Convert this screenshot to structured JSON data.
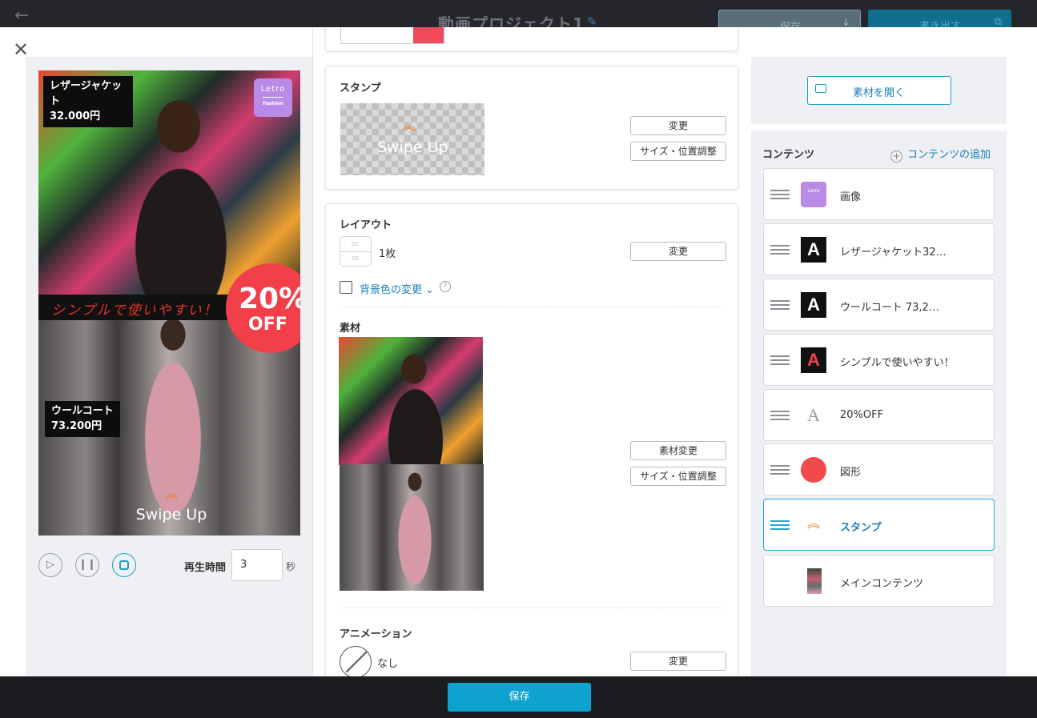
{
  "topbar": {
    "back_icon": "arrow-left-icon",
    "project_title": "動画プロジェクト1",
    "edit_icon": "pencil-icon",
    "save_label": "保存",
    "export_label": "書き出す"
  },
  "modal": {
    "close_icon": "close-icon",
    "preview": {
      "tag_top_line1": "レザージャケット",
      "tag_top_line2": "32.000円",
      "logo_line1": "Letro",
      "logo_line2": "Fashion",
      "catch_text": "シンプルで使いやすい！",
      "badge_percent": "20%",
      "badge_off": "OFF",
      "tag_mid_line1": "ウールコート",
      "tag_mid_line2": "73.200円",
      "stamp_text": "Swipe Up"
    },
    "controls": {
      "duration_label": "再生時間",
      "duration_value": "3",
      "duration_unit": "秒"
    },
    "stamp_section": {
      "title": "スタンプ",
      "stamp_text": "Swipe Up",
      "change_label": "変更",
      "size_label": "サイズ・位置調整"
    },
    "layout_section": {
      "title": "レイアウト",
      "layout_value": "1枚",
      "change_label": "変更",
      "bg_color_label": "背景色の変更 ⌄"
    },
    "material_section": {
      "title": "素材",
      "change_material_label": "素材変更",
      "size_label": "サイズ・位置調整"
    },
    "animation_section": {
      "title": "アニメーション",
      "value": "なし",
      "change_label": "変更"
    },
    "right": {
      "open_material_label": "素材を開く",
      "contents_title": "コンテンツ",
      "add_content_label": "コンテンツの追加",
      "items": [
        {
          "label": "画像",
          "thumb": "image"
        },
        {
          "label": "レザージャケット32…",
          "thumb": "text-A"
        },
        {
          "label": "ウールコート 73,2…",
          "thumb": "text-A"
        },
        {
          "label": "シンプルで使いやすい！",
          "thumb": "text-A-red"
        },
        {
          "label": "20%OFF",
          "thumb": "text-A-outline"
        },
        {
          "label": "図形",
          "thumb": "circle"
        },
        {
          "label": "スタンプ",
          "thumb": "chevron-up",
          "active": true
        },
        {
          "label": "メインコンテンツ",
          "thumb": "photo"
        }
      ]
    },
    "footer": {
      "save_label": "保存"
    }
  },
  "colors": {
    "accent": "#0ea3cf",
    "link": "#1a7fb6",
    "badge": "#f2404a",
    "stamp": "#f07a1a"
  }
}
